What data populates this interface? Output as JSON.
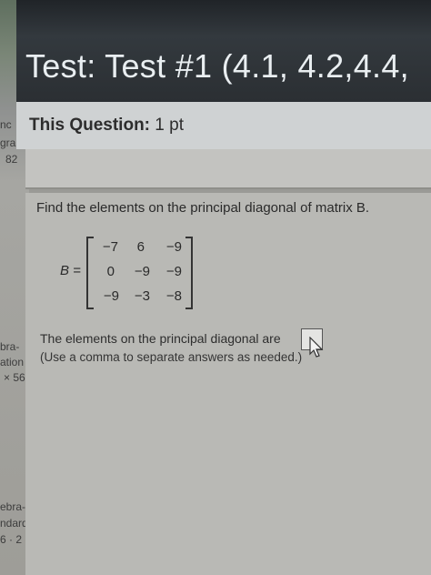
{
  "sidebar": {
    "fragments": [
      "nc",
      "gra",
      "82",
      "bra-",
      "ation",
      "× 56",
      "ebra-",
      "ndard",
      "6 · 2"
    ]
  },
  "header": {
    "title": "Test: Test #1 (4.1, 4.2,4.4,",
    "question_label": "This Question:",
    "question_points": "1 pt"
  },
  "question": {
    "prompt": "Find the elements on the principal diagonal of matrix B.",
    "matrix_label": "B =",
    "matrix": [
      [
        "−7",
        "6",
        "−9"
      ],
      [
        "0",
        "−9",
        "−9"
      ],
      [
        "−9",
        "−3",
        "−8"
      ]
    ],
    "answer_prompt": "The elements on the principal diagonal are",
    "answer_value": "",
    "hint": "(Use a comma to separate answers as needed.)"
  }
}
